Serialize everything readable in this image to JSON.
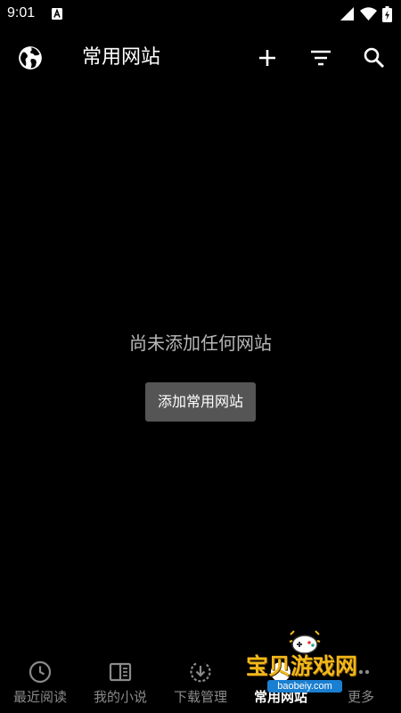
{
  "status_bar": {
    "time": "9:01"
  },
  "app_bar": {
    "title": "常用网站",
    "icons": {
      "left": "globe-icon",
      "add": "plus-icon",
      "filter": "filter-icon",
      "search": "search-icon"
    }
  },
  "empty_state": {
    "message": "尚未添加任何网站",
    "button_label": "添加常用网站"
  },
  "bottom_nav": {
    "items": [
      {
        "label": "最近阅读",
        "icon": "clock-icon",
        "active": false
      },
      {
        "label": "我的小说",
        "icon": "book-icon",
        "active": false
      },
      {
        "label": "下载管理",
        "icon": "download-icon",
        "active": false
      },
      {
        "label": "常用网站",
        "icon": "globe-icon",
        "active": true
      },
      {
        "label": "更多",
        "icon": "more-icon",
        "active": false
      }
    ]
  },
  "watermark": {
    "title": "宝贝游戏网",
    "url": "baobeiy.com"
  },
  "colors": {
    "background": "#000000",
    "button_bg": "#555555",
    "nav_inactive": "#8a8a8a",
    "empty_text": "#b8b8b8",
    "watermark_gold": "#f2b81a",
    "watermark_blue": "#1a7fd0"
  }
}
